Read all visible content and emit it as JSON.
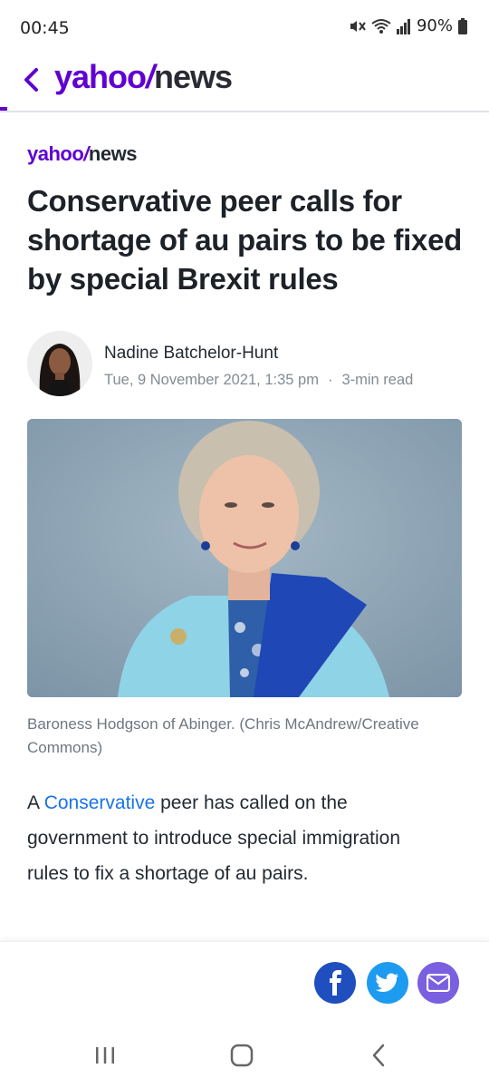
{
  "status": {
    "time": "00:45",
    "battery": "90%"
  },
  "header": {
    "brand_yahoo": "yahoo",
    "brand_bang": "/",
    "brand_news": "news"
  },
  "article": {
    "publisher_yahoo": "yahoo",
    "publisher_bang": "/",
    "publisher_news": "news",
    "headline": "Conservative peer calls for shortage of au pairs to be fixed by special Brexit rules",
    "author": "Nadine Batchelor-Hunt",
    "date": "Tue, 9 November 2021, 1:35 pm",
    "separator": "·",
    "read_time": "3-min read",
    "caption": "Baroness Hodgson of Abinger. (Chris McAndrew/Creative Commons)",
    "body_prefix": "A ",
    "body_link": "Conservative",
    "body_suffix": " peer has called on the government to introduce special immigration rules to fix a shortage of au pairs."
  },
  "share": {
    "facebook_icon": "facebook-icon",
    "twitter_icon": "twitter-icon",
    "email_icon": "email-icon"
  },
  "colors": {
    "brand_purple": "#6001d2",
    "link_blue": "#1a73e8",
    "facebook": "#1f4fbf",
    "twitter": "#1d9bf0",
    "email": "#7a5fe0"
  }
}
